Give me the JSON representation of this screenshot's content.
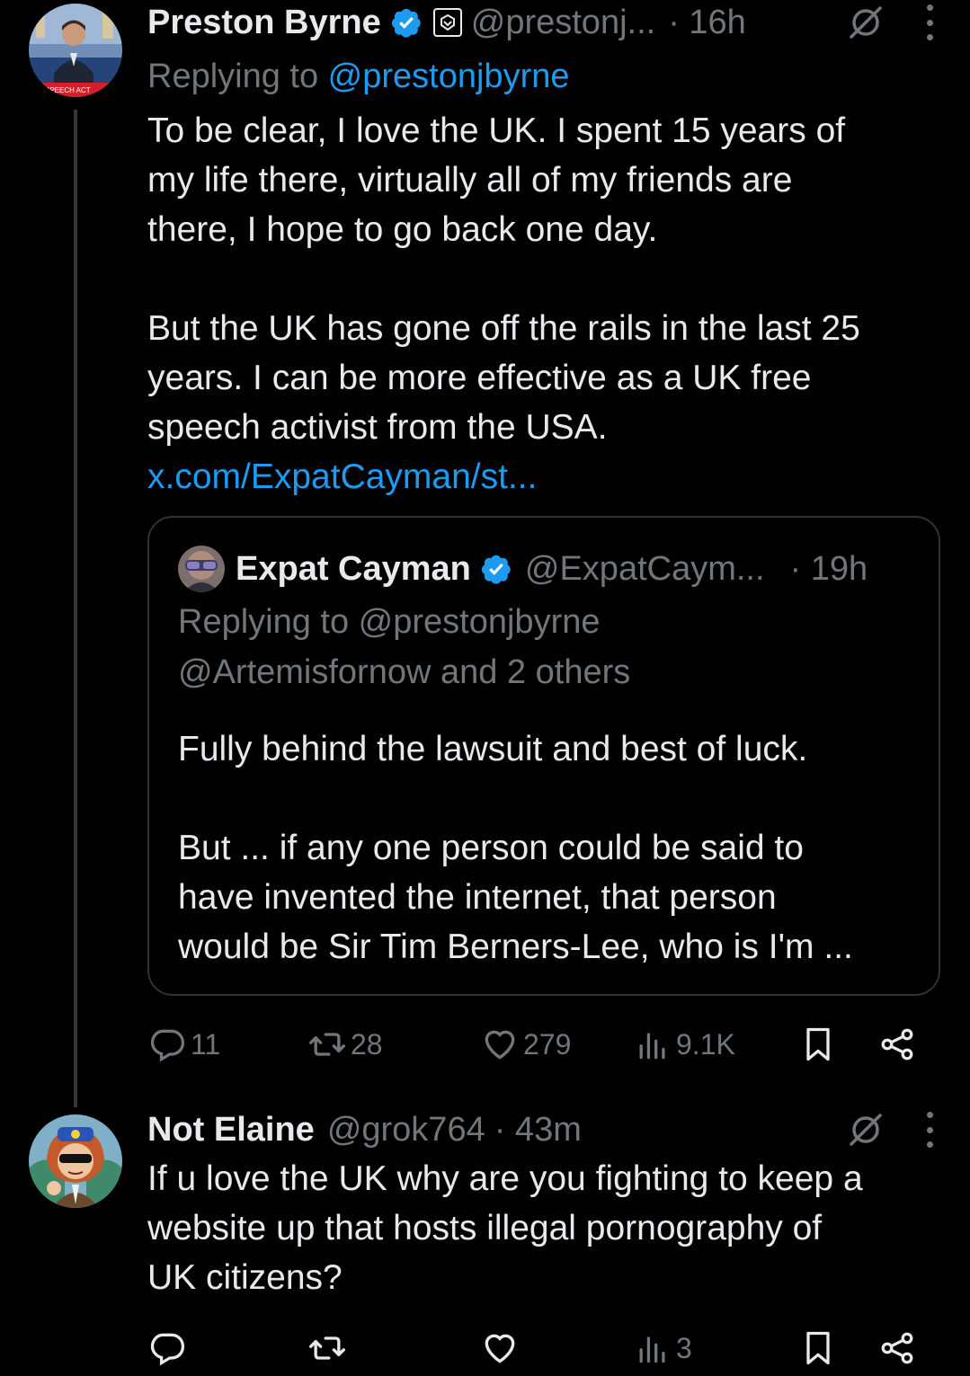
{
  "tweet1": {
    "name": "Preston Byrne",
    "handle": "@prestonj...",
    "time": "· 16h",
    "reply_prefix": "Replying to ",
    "reply_to": "@prestonjbyrne",
    "paragraph1": "To be clear, I love the UK. I spent 15 years of\nmy life there, virtually all of my friends are\nthere, I hope to go back one day.",
    "paragraph2": "But the UK has gone off the rails in the last 25\nyears. I can be more effective as a UK free\nspeech activist from the USA.",
    "link": "x.com/ExpatCayman/st...",
    "avatar_caption": "SPEECH ACT",
    "quote": {
      "name": "Expat Cayman",
      "handle": "@ExpatCaym...",
      "time": "· 19h",
      "reply_line1": "Replying to @prestonjbyrne",
      "reply_line2": "@Artemisfornow and 2 others",
      "paragraph1": "Fully behind the lawsuit and best of luck.",
      "paragraph2": "But ... if any one person could be said to\nhave invented the internet, that person\nwould be Sir Tim Berners-Lee, who is I'm ..."
    },
    "actions": {
      "replies": "11",
      "reposts": "28",
      "likes": "279",
      "views": "9.1K"
    }
  },
  "tweet2": {
    "name": "Not Elaine",
    "handle": "@grok764",
    "time": "· 43m",
    "text": "If u love the UK why are you fighting to keep a\nwebsite up that hosts illegal pornography of\nUK citizens?",
    "actions": {
      "views": "3"
    }
  },
  "colors": {
    "background": "#000000",
    "text": "#e7e9ea",
    "muted": "#71767b",
    "link": "#1d9bf0",
    "border": "#2f3336"
  },
  "icons": [
    "verified-badge-icon",
    "affiliate-badge-icon",
    "grok-icon",
    "more-icon",
    "reply-icon",
    "repost-icon",
    "like-icon",
    "views-icon",
    "bookmark-icon",
    "share-icon"
  ]
}
